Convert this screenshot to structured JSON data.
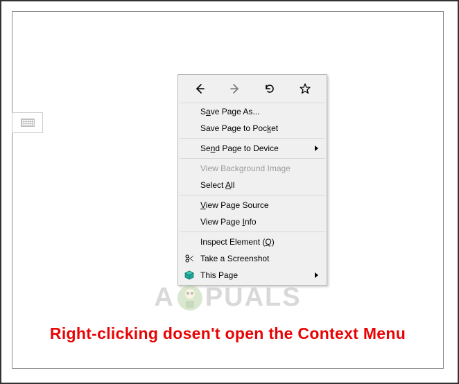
{
  "contextMenu": {
    "toolbar": {
      "back": "Back",
      "forward": "Forward",
      "reload": "Reload",
      "bookmark": "Bookmark"
    },
    "items": [
      {
        "label_html": "S<u>a</u>ve Page As..."
      },
      {
        "label_html": "Save Page to Poc<u>k</u>et"
      },
      {
        "sep": true
      },
      {
        "label_html": "Se<u>n</u>d Page to Device",
        "submenu": true
      },
      {
        "sep": true
      },
      {
        "label_html": "View Back<u>g</u>round Image",
        "disabled": true
      },
      {
        "label_html": "Select <u>A</u>ll"
      },
      {
        "sep": true
      },
      {
        "label_html": "<u>V</u>iew Page Source"
      },
      {
        "label_html": "View Page <u>I</u>nfo"
      },
      {
        "sep": true
      },
      {
        "label_html": "Inspect Element (<u>Q</u>)"
      },
      {
        "label_html": "Take a Screenshot",
        "icon": "scissors"
      },
      {
        "label_html": "This Page",
        "icon": "cube",
        "submenu": true
      }
    ]
  },
  "watermark": {
    "left": "A",
    "right": "PUALS"
  },
  "caption": "Right-clicking dosen't open the Context Menu"
}
